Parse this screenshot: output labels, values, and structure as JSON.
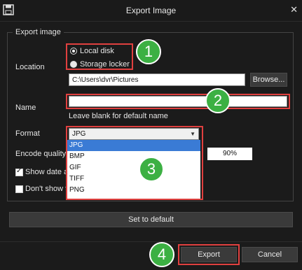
{
  "window": {
    "title": "Export Image",
    "close_glyph": "✕"
  },
  "group": {
    "label": "Export image"
  },
  "location": {
    "label": "Location",
    "options": [
      {
        "label": "Local disk",
        "selected": true
      },
      {
        "label": "Storage locker",
        "selected": false
      }
    ],
    "path": "C:\\Users\\dvr\\Pictures",
    "browse_label": "Browse..."
  },
  "name": {
    "label": "Name",
    "value": "",
    "hint": "Leave blank for default name"
  },
  "format": {
    "label": "Format",
    "selected": "JPG",
    "options": [
      "JPG",
      "BMP",
      "GIF",
      "TIFF",
      "PNG"
    ]
  },
  "encode_quality": {
    "label": "Encode quality",
    "value": "90%"
  },
  "checkboxes": [
    {
      "label": "Show date a",
      "checked": true
    },
    {
      "label": "Don't show t",
      "checked": false
    }
  ],
  "buttons": {
    "default": "Set to default",
    "export": "Export",
    "cancel": "Cancel"
  },
  "annotations": [
    "1",
    "2",
    "3",
    "4"
  ],
  "colors": {
    "highlight": "#e0403f",
    "badge": "#3cb043",
    "background": "#1b1b1b"
  }
}
